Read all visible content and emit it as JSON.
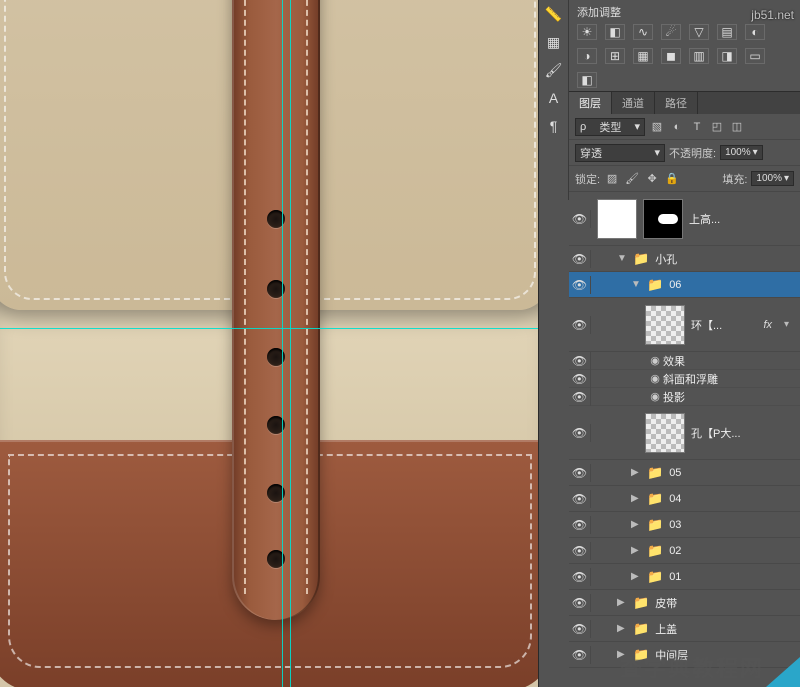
{
  "watermark_top": "jb51.net",
  "watermark_bottom": "查字典教程网",
  "adjustments": {
    "title": "添加调整"
  },
  "tabs": {
    "layers": "图层",
    "channels": "通道",
    "paths": "路径"
  },
  "filter_row": {
    "kind_prefix": "ρ",
    "kind_label": "类型"
  },
  "blend_row": {
    "mode": "穿透",
    "opacity_label": "不透明度:",
    "opacity_value": "100%"
  },
  "lock_row": {
    "lock_label": "锁定:",
    "fill_label": "填充:",
    "fill_value": "100%"
  },
  "layers_tree": {
    "top_layer": {
      "name": "上高..."
    },
    "group_holes": {
      "name": "小孔"
    },
    "group_06": {
      "name": "06"
    },
    "ring_layer": {
      "name": "环【...",
      "fx_abbr": "fx"
    },
    "effects_label": "效果",
    "effect_bevel": "斜面和浮雕",
    "effect_shadow": "投影",
    "hole_layer": {
      "name": "孔【P大..."
    },
    "group_05": {
      "name": "05"
    },
    "group_04": {
      "name": "04"
    },
    "group_03": {
      "name": "03"
    },
    "group_02": {
      "name": "02"
    },
    "group_01": {
      "name": "01"
    },
    "group_belt": {
      "name": "皮带"
    },
    "group_topcover": {
      "name": "上盖"
    },
    "group_midlayer": {
      "name": "中间层"
    }
  }
}
